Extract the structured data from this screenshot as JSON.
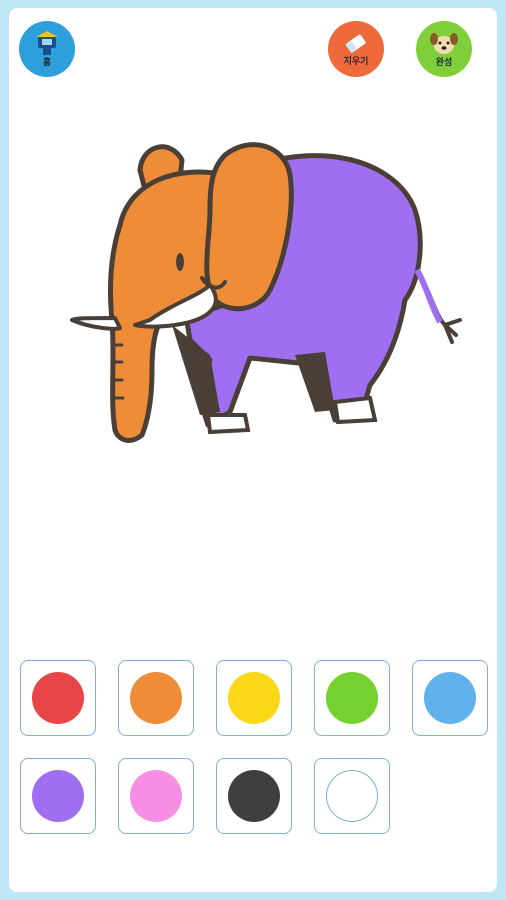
{
  "toolbar": {
    "home_label": "홈",
    "erase_label": "지우기",
    "done_label": "완성"
  },
  "colors": {
    "background": "#bfe6f7",
    "elephant_head": "#ef8c38",
    "elephant_body": "#a06ef0",
    "outline": "#4a3f36",
    "home_badge": "#2d9fdc",
    "erase_badge": "#ee6a3a",
    "done_badge": "#7fcf3a"
  },
  "palette": [
    {
      "name": "red",
      "hex": "#e84548"
    },
    {
      "name": "orange",
      "hex": "#ef8c38"
    },
    {
      "name": "yellow",
      "hex": "#fcd718"
    },
    {
      "name": "green",
      "hex": "#75d12f"
    },
    {
      "name": "blue",
      "hex": "#5fb2ec"
    },
    {
      "name": "purple",
      "hex": "#a06ef0"
    },
    {
      "name": "pink",
      "hex": "#f78ee5"
    },
    {
      "name": "black",
      "hex": "#3f3f3f"
    },
    {
      "name": "white",
      "hex": "#ffffff"
    }
  ],
  "icons": {
    "home": "home-icon",
    "erase": "eraser-icon",
    "done": "dog-face-icon"
  }
}
